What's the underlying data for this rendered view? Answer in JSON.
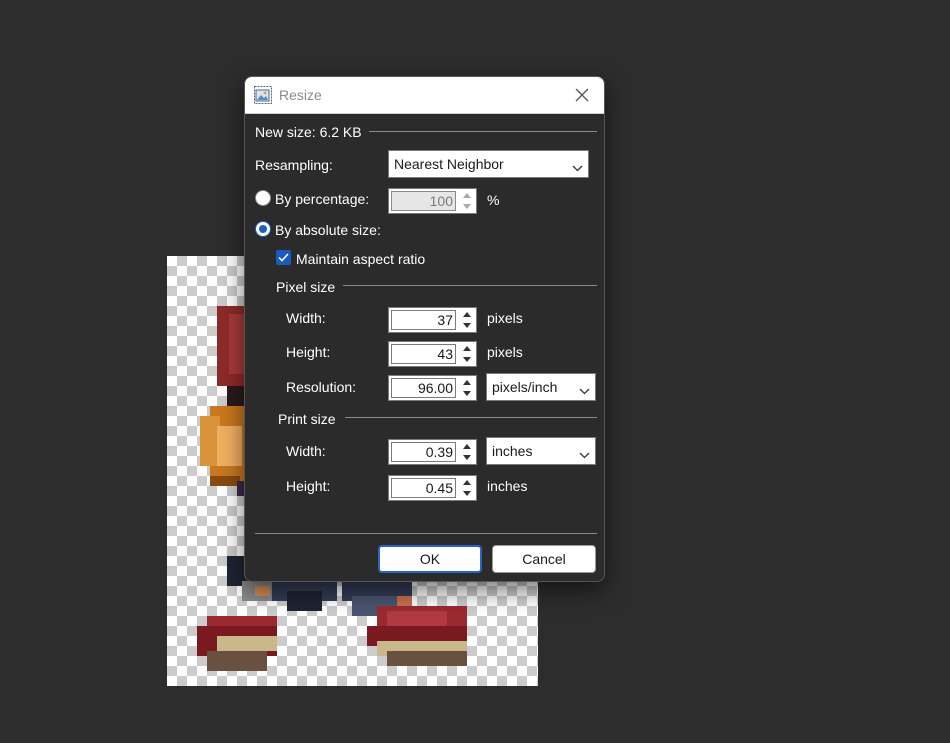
{
  "dialog": {
    "title": "Resize",
    "new_size": "New size: 6.2 KB",
    "resampling": {
      "label": "Resampling:",
      "value": "Nearest Neighbor"
    },
    "by_percentage": {
      "label": "By percentage:",
      "value": "100",
      "unit": "%",
      "selected": false
    },
    "by_absolute": {
      "label": "By absolute size:",
      "selected": true
    },
    "maintain_aspect": {
      "label": "Maintain aspect ratio",
      "checked": true
    },
    "pixel_size": {
      "header": "Pixel size",
      "width": {
        "label": "Width:",
        "value": "37",
        "unit": "pixels"
      },
      "height": {
        "label": "Height:",
        "value": "43",
        "unit": "pixels"
      },
      "resolution": {
        "label": "Resolution:",
        "value": "96.00",
        "unit": "pixels/inch"
      }
    },
    "print_size": {
      "header": "Print size",
      "width": {
        "label": "Width:",
        "value": "0.39",
        "unit": "inches"
      },
      "height": {
        "label": "Height:",
        "value": "0.45",
        "unit": "inches"
      }
    },
    "ok_label": "OK",
    "cancel_label": "Cancel"
  },
  "icons": {
    "app": "image-resize-icon",
    "close": "close-icon",
    "dropdown": "chevron-down-icon",
    "spin_up": "spin-up-icon",
    "spin_down": "spin-down-icon",
    "check": "checkmark-icon"
  },
  "colors": {
    "workspace": "#2d2d2d",
    "dialog_bg": "#2b2b2b",
    "accent": "#1c5bbd"
  }
}
